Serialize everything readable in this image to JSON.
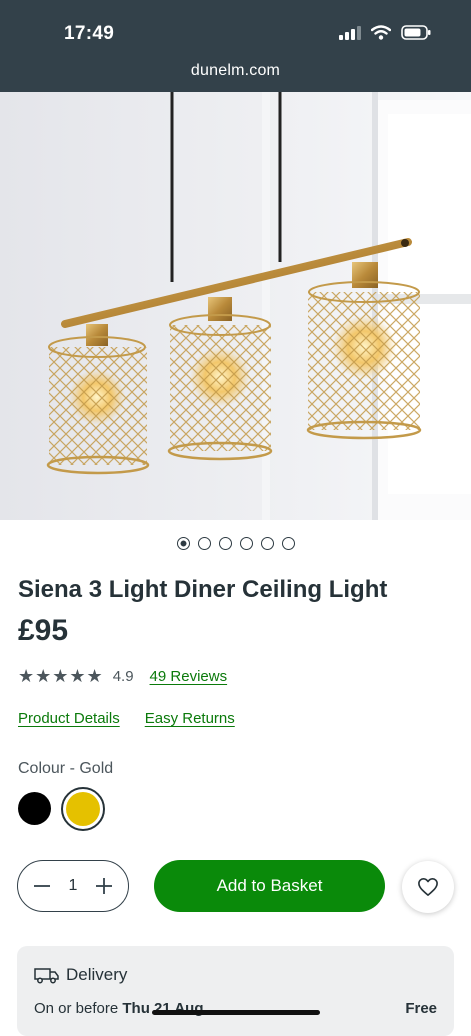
{
  "status_bar": {
    "time": "17:49",
    "url": "dunelm.com"
  },
  "gallery": {
    "image_count": 6,
    "active_index": 0
  },
  "product": {
    "title": "Siena 3 Light Diner Ceiling Light",
    "price": "£95",
    "rating": {
      "stars": 5,
      "value": "4.9",
      "reviews_label": "49 Reviews"
    },
    "links": {
      "details": "Product Details",
      "returns": "Easy Returns"
    }
  },
  "colour": {
    "label": "Colour - Gold",
    "options": [
      {
        "name": "black",
        "hex": "#000000",
        "selected": false
      },
      {
        "name": "gold",
        "hex": "#e5c100",
        "selected": true
      }
    ]
  },
  "basket": {
    "quantity": "1",
    "add_label": "Add to Basket"
  },
  "delivery": {
    "heading": "Delivery",
    "line_prefix": "On or before ",
    "date": "Thu 21 Aug",
    "price": "Free"
  },
  "colors": {
    "brand_green": "#0a8a0a",
    "header_bg": "#33414a",
    "link_green": "#0b7a0b"
  }
}
